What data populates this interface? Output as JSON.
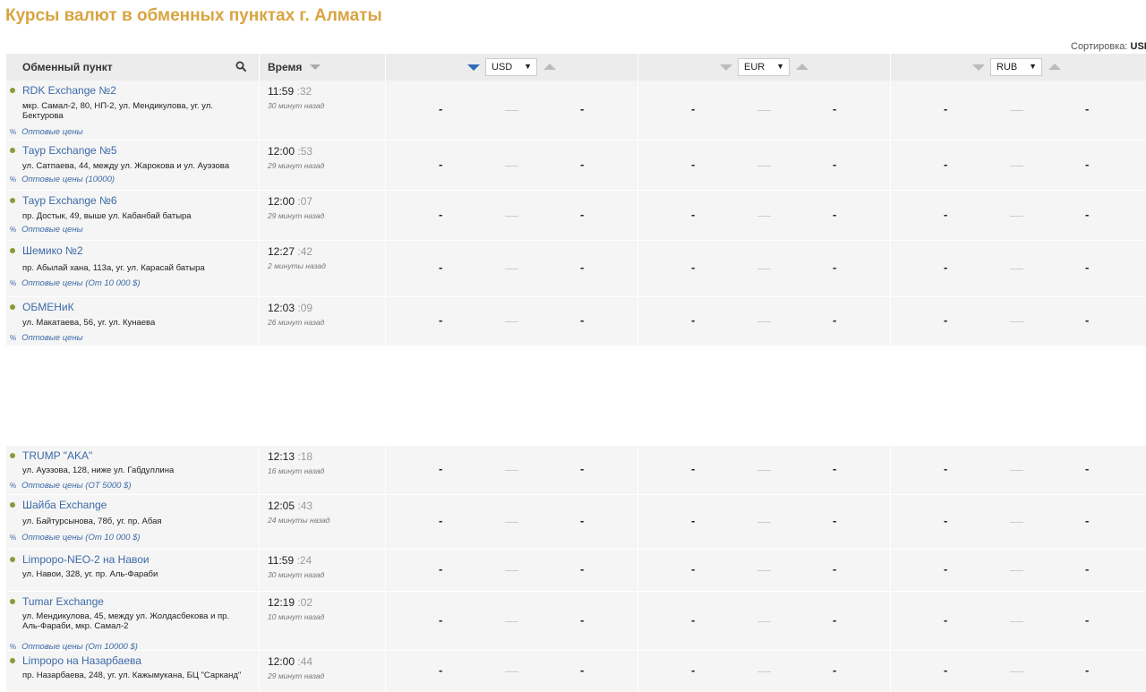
{
  "page": {
    "title": "Курсы валют в обменных пунктах г. Алматы"
  },
  "sort": {
    "label": "Сортировка:",
    "value": "USI"
  },
  "header": {
    "point_label": "Обменный пункт",
    "time_label": "Время",
    "currencies": [
      {
        "code": "USD",
        "active": true
      },
      {
        "code": "EUR",
        "active": false
      },
      {
        "code": "RUB",
        "active": false
      }
    ]
  },
  "rows": [
    {
      "name": "RDK Exchange №2",
      "address": "мкр. Самал-2, 80, НП-2, ул. Мендикулова, уг. ул. Бектурова",
      "wholesale": "Оптовые цены",
      "time": "11:59",
      "sec": ":32",
      "ago": "30 минут назад",
      "rates": [
        {
          "buy": "-",
          "sep": "—",
          "sell": "-"
        },
        {
          "buy": "-",
          "sep": "—",
          "sell": "-"
        },
        {
          "buy": "-",
          "sep": "—",
          "sell": "-"
        }
      ]
    },
    {
      "name": "Тауp Exchange №5",
      "address": "ул. Сатпаева, 44, между ул. Жарокова и ул. Ауэзова",
      "wholesale": "Оптовые цены (10000)",
      "time": "12:00",
      "sec": ":53",
      "ago": "29 минут назад",
      "rates": [
        {
          "buy": "-",
          "sep": "—",
          "sell": "-"
        },
        {
          "buy": "-",
          "sep": "—",
          "sell": "-"
        },
        {
          "buy": "-",
          "sep": "—",
          "sell": "-"
        }
      ]
    },
    {
      "name": "Тауp Exchange №6",
      "address": "пр. Достык, 49, выше ул. Кабанбай батыра",
      "wholesale": "Оптовые цены",
      "time": "12:00",
      "sec": ":07",
      "ago": "29 минут назад",
      "rates": [
        {
          "buy": "-",
          "sep": "—",
          "sell": "-"
        },
        {
          "buy": "-",
          "sep": "—",
          "sell": "-"
        },
        {
          "buy": "-",
          "sep": "—",
          "sell": "-"
        }
      ]
    },
    {
      "name": "Шемико №2",
      "address": "пр. Абылай хана, 113а, уг. ул. Карасай батыра",
      "wholesale": "Оптовые цены (От 10 000 $)",
      "time": "12:27",
      "sec": ":42",
      "ago": "2 минуты назад",
      "rates": [
        {
          "buy": "-",
          "sep": "—",
          "sell": "-"
        },
        {
          "buy": "-",
          "sep": "—",
          "sell": "-"
        },
        {
          "buy": "-",
          "sep": "—",
          "sell": "-"
        }
      ]
    },
    {
      "name": "ОБМЕНиК",
      "address": "ул. Макатаева, 56, уг. ул. Кунаева",
      "wholesale": "Оптовые цены",
      "time": "12:03",
      "sec": ":09",
      "ago": "26 минут назад",
      "rates": [
        {
          "buy": "-",
          "sep": "—",
          "sell": "-"
        },
        {
          "buy": "-",
          "sep": "—",
          "sell": "-"
        },
        {
          "buy": "-",
          "sep": "—",
          "sell": "-"
        }
      ]
    },
    {
      "name": "TRUMP \"AKA\"",
      "address": "ул. Ауэзова, 128, ниже ул. Габдуллина",
      "wholesale": "Оптовые цены (ОТ 5000 $)",
      "time": "12:13",
      "sec": ":18",
      "ago": "16 минут назад",
      "rates": [
        {
          "buy": "-",
          "sep": "—",
          "sell": "-"
        },
        {
          "buy": "-",
          "sep": "—",
          "sell": "-"
        },
        {
          "buy": "-",
          "sep": "—",
          "sell": "-"
        }
      ]
    },
    {
      "name": "Шайба Exchange",
      "address": "ул. Байтурсынова, 78б, уг. пр. Абая",
      "wholesale": "Оптовые цены (От 10 000 $)",
      "time": "12:05",
      "sec": ":43",
      "ago": "24 минуты назад",
      "rates": [
        {
          "buy": "-",
          "sep": "—",
          "sell": "-"
        },
        {
          "buy": "-",
          "sep": "—",
          "sell": "-"
        },
        {
          "buy": "-",
          "sep": "—",
          "sell": "-"
        }
      ]
    },
    {
      "name": "Limpopo-NEO-2 на Навои",
      "address": "ул. Навои, 328, уг. пр. Аль-Фараби",
      "wholesale": "",
      "time": "11:59",
      "sec": ":24",
      "ago": "30 минут назад",
      "rates": [
        {
          "buy": "-",
          "sep": "—",
          "sell": "-"
        },
        {
          "buy": "-",
          "sep": "—",
          "sell": "-"
        },
        {
          "buy": "-",
          "sep": "—",
          "sell": "-"
        }
      ]
    },
    {
      "name": "Tumar Exchange",
      "address": "ул. Мендикулова, 45, между ул. Жолдасбекова и пр. Аль-Фараби, мкр. Самал-2",
      "wholesale": "Оптовые цены (От 10000 $)",
      "time": "12:19",
      "sec": ":02",
      "ago": "10 минут назад",
      "rates": [
        {
          "buy": "-",
          "sep": "—",
          "sell": "-"
        },
        {
          "buy": "-",
          "sep": "—",
          "sell": "-"
        },
        {
          "buy": "-",
          "sep": "—",
          "sell": "-"
        }
      ]
    },
    {
      "name": "Limpopo на Назарбаева",
      "address": "пр. Назарбаева, 248, уг. ул. Кажымукана, БЦ \"Сарканд\"",
      "wholesale": "",
      "time": "12:00",
      "sec": ":44",
      "ago": "29 минут назад",
      "rates": [
        {
          "buy": "-",
          "sep": "—",
          "sell": "-"
        },
        {
          "buy": "-",
          "sep": "—",
          "sell": "-"
        },
        {
          "buy": "-",
          "sep": "—",
          "sell": "-"
        }
      ]
    }
  ]
}
